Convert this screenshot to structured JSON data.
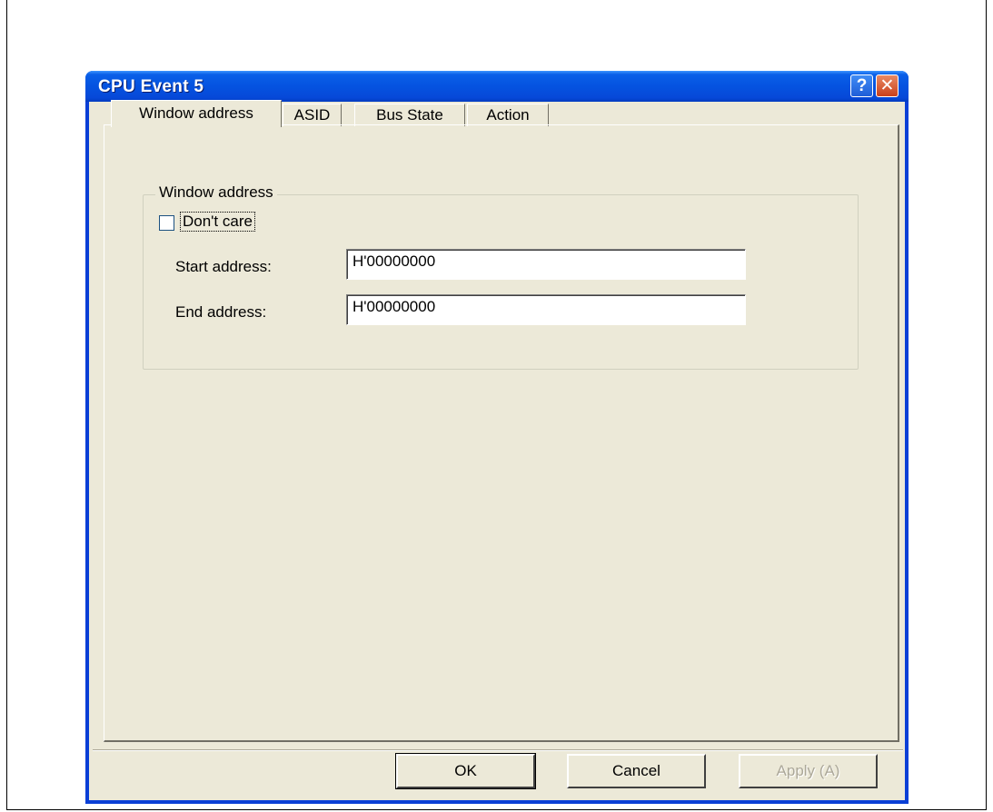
{
  "window": {
    "title": "CPU Event 5",
    "help_glyph": "?",
    "close_glyph": "✕"
  },
  "tabs": [
    {
      "label": "Window address",
      "active": true
    },
    {
      "label": "ASID",
      "active": false
    },
    {
      "label": "Bus State",
      "active": false
    },
    {
      "label": "Action",
      "active": false
    }
  ],
  "group": {
    "label": "Window address",
    "dont_care": {
      "label": "Don't care",
      "checked": false
    },
    "start_address": {
      "label": "Start address:",
      "value": "H'00000000"
    },
    "end_address": {
      "label": "End address:",
      "value": "H'00000000"
    }
  },
  "buttons": {
    "ok": "OK",
    "cancel": "Cancel",
    "apply": "Apply (A)",
    "apply_enabled": false
  },
  "colors": {
    "titlebar": "#0553e0",
    "face": "#ece9d8",
    "close": "#c9401c"
  },
  "icons": [
    "help-icon",
    "close-icon"
  ]
}
